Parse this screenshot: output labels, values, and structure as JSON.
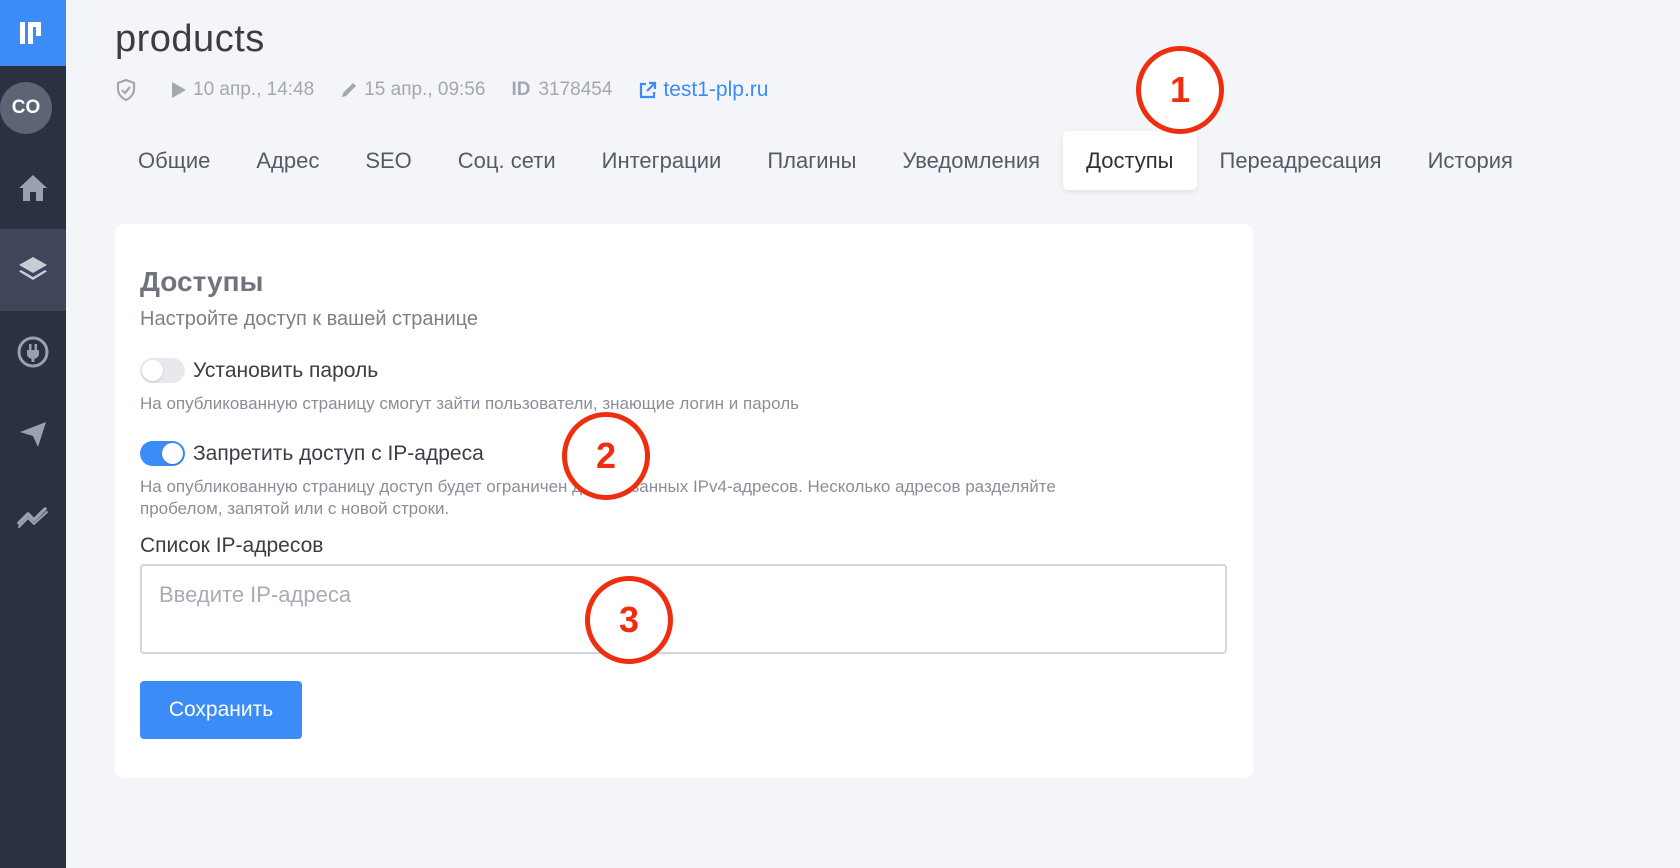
{
  "app": {
    "accent_color": "#3b8cf6",
    "sidebar_color": "#2c3142",
    "marker_color": "#ef2d0f"
  },
  "sidebar": {
    "logo_icon": "logo-icon",
    "avatar_initials": "CO",
    "items": [
      {
        "icon": "home-icon",
        "active": false
      },
      {
        "icon": "layers-icon",
        "active": true
      },
      {
        "icon": "plug-icon",
        "active": false
      },
      {
        "icon": "send-icon",
        "active": false
      },
      {
        "icon": "trend-icon",
        "active": false
      }
    ]
  },
  "header": {
    "title": "products",
    "meta": {
      "published": "10 апр., 14:48",
      "edited": "15 апр., 09:56",
      "id_label": "ID",
      "id_value": "3178454",
      "domain": "test1-plp.ru"
    }
  },
  "tabs": [
    {
      "label": "Общие",
      "active": false
    },
    {
      "label": "Адрес",
      "active": false
    },
    {
      "label": "SEO",
      "active": false
    },
    {
      "label": "Соц. сети",
      "active": false
    },
    {
      "label": "Интеграции",
      "active": false
    },
    {
      "label": "Плагины",
      "active": false
    },
    {
      "label": "Уведомления",
      "active": false
    },
    {
      "label": "Доступы",
      "active": true
    },
    {
      "label": "Переадресация",
      "active": false
    },
    {
      "label": "История",
      "active": false
    }
  ],
  "access": {
    "title": "Доступы",
    "subtitle": "Настройте доступ к вашей странице",
    "password": {
      "label": "Установить пароль",
      "enabled": false,
      "description": "На опубликованную страницу смогут зайти пользователи, знающие логин и пароль"
    },
    "ip_block": {
      "label": "Запретить доступ с IP-адреса",
      "enabled": true,
      "description_line1": "На опубликованную страницу доступ будет ограничен для указанных IPv4-адресов. Несколько адресов разделяйте",
      "description_line2": "пробелом, запятой или с новой строки."
    },
    "ip_list": {
      "label": "Список IP-адресов",
      "placeholder": "Введите IP-адреса",
      "value": ""
    },
    "save_label": "Сохранить"
  },
  "markers": [
    "1",
    "2",
    "3"
  ]
}
